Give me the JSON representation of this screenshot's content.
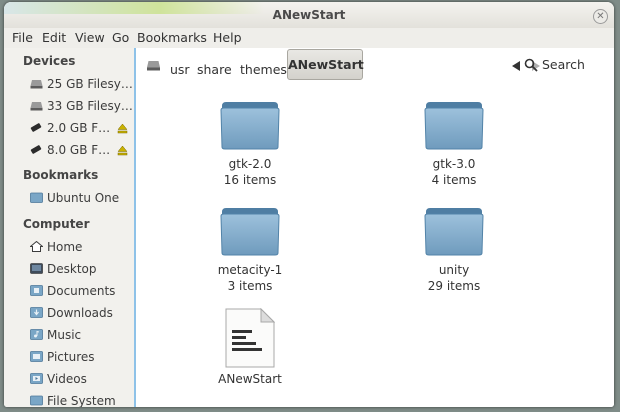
{
  "window": {
    "title": "ANewStart"
  },
  "menu": [
    "File",
    "Edit",
    "View",
    "Go",
    "Bookmarks",
    "Help"
  ],
  "sidebar": {
    "devices_heading": "Devices",
    "devices": [
      {
        "label": "25 GB Filesy…",
        "icon": "drive-harddisk-icon",
        "eject": false
      },
      {
        "label": "33 GB Filesy…",
        "icon": "drive-harddisk-icon",
        "eject": false
      },
      {
        "label": "2.0 GB F…",
        "icon": "usb-drive-icon",
        "eject": true
      },
      {
        "label": "8.0 GB F…",
        "icon": "usb-drive-icon",
        "eject": true
      }
    ],
    "bookmarks_heading": "Bookmarks",
    "bookmarks": [
      {
        "label": "Ubuntu One",
        "icon": "folder-icon"
      }
    ],
    "computer_heading": "Computer",
    "computer": [
      {
        "label": "Home",
        "icon": "home-icon"
      },
      {
        "label": "Desktop",
        "icon": "desktop-icon"
      },
      {
        "label": "Documents",
        "icon": "documents-folder-icon"
      },
      {
        "label": "Downloads",
        "icon": "downloads-folder-icon"
      },
      {
        "label": "Music",
        "icon": "music-folder-icon"
      },
      {
        "label": "Pictures",
        "icon": "pictures-folder-icon"
      },
      {
        "label": "Videos",
        "icon": "videos-folder-icon"
      },
      {
        "label": "File System",
        "icon": "filesystem-icon"
      }
    ]
  },
  "toolbar": {
    "breadcrumbs": [
      "usr",
      "share",
      "themes"
    ],
    "current": "ANewStart",
    "search_label": "Search"
  },
  "files": [
    {
      "name": "gtk-2.0",
      "sub": "16 items",
      "type": "folder"
    },
    {
      "name": "gtk-3.0",
      "sub": "4 items",
      "type": "folder"
    },
    {
      "name": "metacity-1",
      "sub": "3 items",
      "type": "folder"
    },
    {
      "name": "unity",
      "sub": "29 items",
      "type": "folder"
    },
    {
      "name": "ANewStart",
      "sub": "",
      "type": "text-file"
    }
  ],
  "colors": {
    "accent": "#8ec2e8",
    "folder": "#7aa6c6"
  }
}
